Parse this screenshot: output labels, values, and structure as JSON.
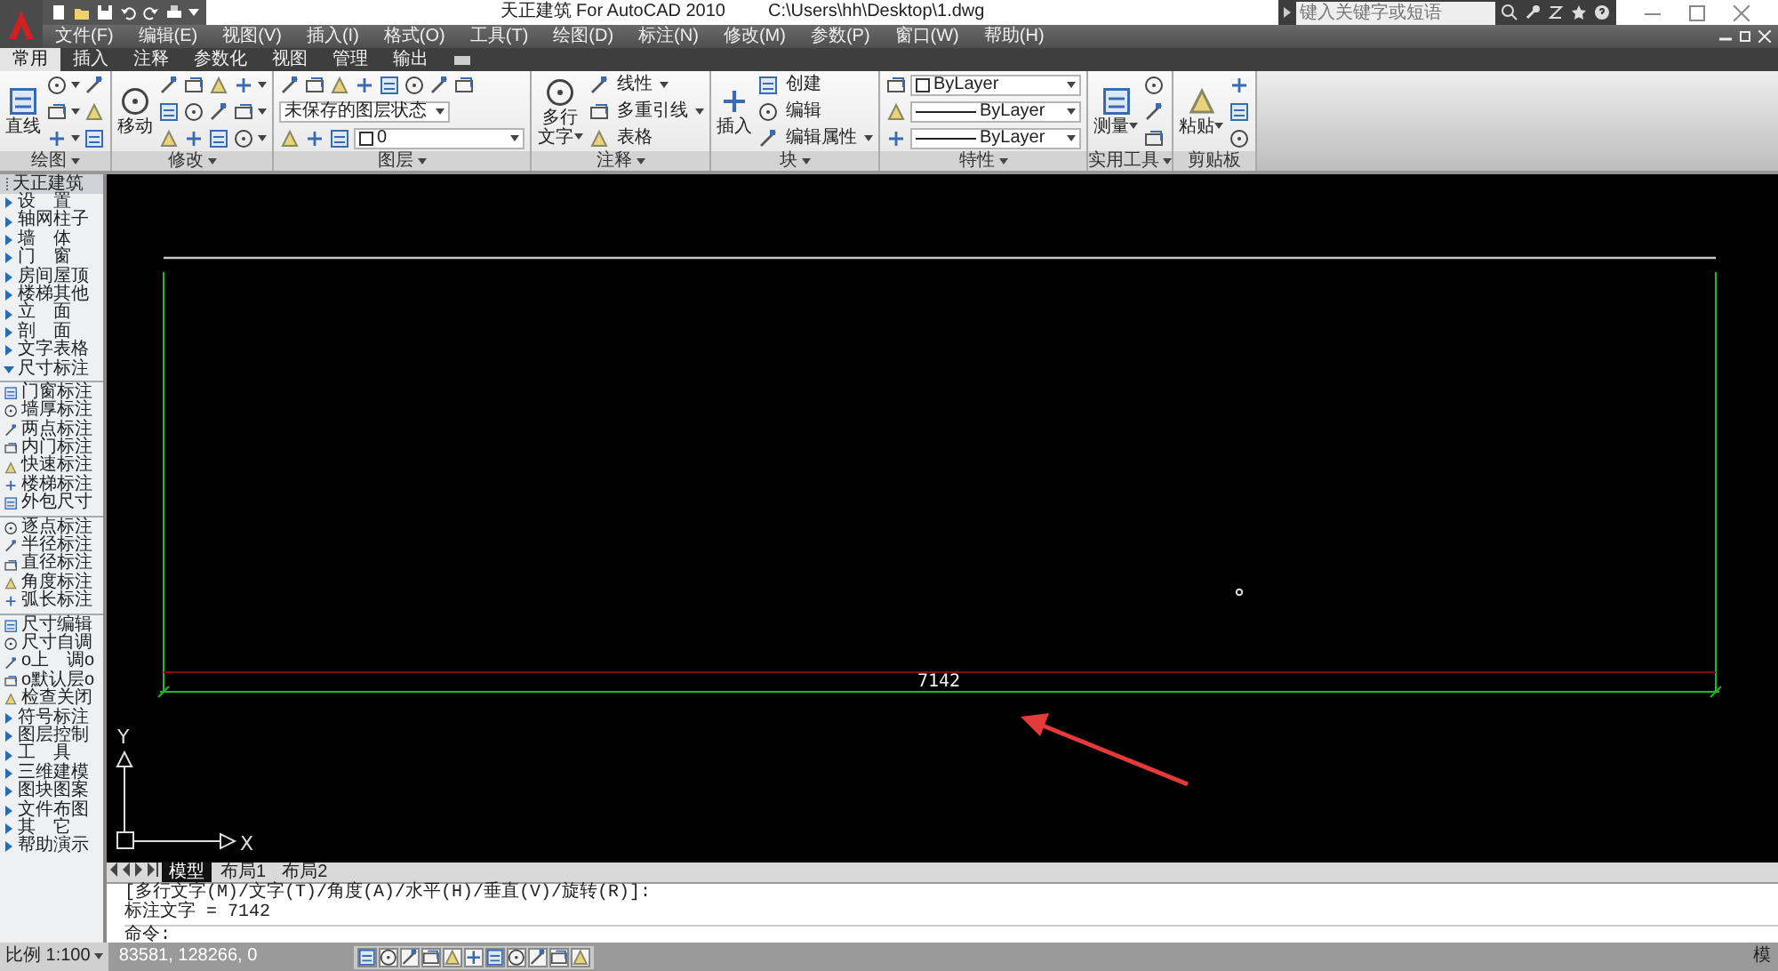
{
  "title_bar": {
    "app_title": "天正建筑 For AutoCAD 2010",
    "file_path": "C:\\Users\\hh\\Desktop\\1.dwg",
    "search": {
      "placeholder": "键入关键字或短语"
    }
  },
  "menu_bar": [
    "文件(F)",
    "编辑(E)",
    "视图(V)",
    "插入(I)",
    "格式(O)",
    "工具(T)",
    "绘图(D)",
    "标注(N)",
    "修改(M)",
    "参数(P)",
    "窗口(W)",
    "帮助(H)"
  ],
  "ribbon_tabs": [
    {
      "label": "常用",
      "selected": true
    },
    {
      "label": "插入",
      "selected": false
    },
    {
      "label": "注释",
      "selected": false
    },
    {
      "label": "参数化",
      "selected": false
    },
    {
      "label": "视图",
      "selected": false
    },
    {
      "label": "管理",
      "selected": false
    },
    {
      "label": "输出",
      "selected": false
    }
  ],
  "ribbon_panels": [
    {
      "title": "绘图",
      "title_menu": true,
      "large": [
        {
          "label": "直线",
          "menu": false
        }
      ],
      "rows": [
        [
          {
            "kind": "icon",
            "menu": true
          },
          {
            "kind": "icon",
            "menu": false
          }
        ],
        [
          {
            "kind": "icon",
            "menu": true
          },
          {
            "kind": "icon",
            "menu": false
          }
        ],
        [
          {
            "kind": "icon",
            "menu": true
          },
          {
            "kind": "icon",
            "menu": false
          }
        ]
      ]
    },
    {
      "title": "修改",
      "title_menu": true,
      "large": [
        {
          "label": "移动",
          "menu": false
        }
      ],
      "rows": [
        [
          {
            "kind": "icon",
            "menu": false
          },
          {
            "kind": "icon",
            "menu": false
          },
          {
            "kind": "icon",
            "menu": false
          },
          {
            "kind": "icon",
            "menu": true
          }
        ],
        [
          {
            "kind": "icon",
            "menu": false
          },
          {
            "kind": "icon",
            "menu": false
          },
          {
            "kind": "icon",
            "menu": false
          },
          {
            "kind": "icon",
            "menu": true
          }
        ],
        [
          {
            "kind": "icon",
            "menu": false
          },
          {
            "kind": "icon",
            "menu": false
          },
          {
            "kind": "icon",
            "menu": false
          },
          {
            "kind": "icon",
            "menu": true
          }
        ]
      ]
    },
    {
      "title": "图层",
      "title_menu": true,
      "rows": [
        [
          {
            "kind": "icon",
            "menu": false
          },
          {
            "kind": "icon",
            "menu": false
          },
          {
            "kind": "icon",
            "menu": false
          },
          {
            "kind": "icon",
            "menu": false
          },
          {
            "kind": "icon",
            "menu": false
          },
          {
            "kind": "icon",
            "menu": false
          },
          {
            "kind": "icon",
            "menu": false
          },
          {
            "kind": "icon",
            "menu": false
          }
        ],
        [
          {
            "kind": "dropdown",
            "value": "未保存的图层状态"
          }
        ],
        [
          {
            "kind": "icon",
            "menu": false
          },
          {
            "kind": "icon",
            "menu": false
          },
          {
            "kind": "icon",
            "menu": false
          },
          {
            "kind": "dropdown",
            "value": "0"
          }
        ]
      ]
    },
    {
      "title": "注释",
      "title_menu": true,
      "large": [
        {
          "label": "多行文字",
          "menu": true
        }
      ],
      "rows": [
        [
          {
            "kind": "labeled",
            "label": "线性",
            "menu": true
          }
        ],
        [
          {
            "kind": "labeled",
            "label": "多重引线",
            "menu": true
          }
        ],
        [
          {
            "kind": "labeled",
            "label": "表格",
            "menu": false
          }
        ]
      ]
    },
    {
      "title": "块",
      "title_menu": true,
      "large": [
        {
          "label": "插入",
          "menu": false
        }
      ],
      "rows": [
        [
          {
            "kind": "labeled",
            "label": "创建",
            "menu": false
          }
        ],
        [
          {
            "kind": "labeled",
            "label": "编辑",
            "menu": false
          }
        ],
        [
          {
            "kind": "labeled",
            "label": "编辑属性",
            "menu": true
          }
        ]
      ]
    },
    {
      "title": "特性",
      "title_menu": true,
      "rows": [
        [
          {
            "kind": "icon",
            "menu": false
          },
          {
            "kind": "dropdown",
            "value": "ByLayer"
          }
        ],
        [
          {
            "kind": "icon",
            "menu": false
          },
          {
            "kind": "dropdown",
            "value": "ByLayer"
          }
        ],
        [
          {
            "kind": "icon",
            "menu": false
          },
          {
            "kind": "dropdown",
            "value": "ByLayer"
          }
        ]
      ]
    },
    {
      "title": "实用工具",
      "title_menu": true,
      "large": [
        {
          "label": "测量",
          "menu": true
        }
      ],
      "rows": [
        [
          {
            "kind": "icon",
            "menu": false
          }
        ],
        [
          {
            "kind": "icon",
            "menu": false
          }
        ],
        [
          {
            "kind": "icon",
            "menu": false
          }
        ]
      ]
    },
    {
      "title": "剪贴板",
      "title_menu": false,
      "large": [
        {
          "label": "粘贴",
          "menu": true
        }
      ],
      "rows": [
        [
          {
            "kind": "icon",
            "menu": false
          }
        ],
        [
          {
            "kind": "icon",
            "menu": false
          }
        ],
        [
          {
            "kind": "icon",
            "menu": false
          }
        ]
      ]
    }
  ],
  "palette": {
    "title": "天正建筑",
    "items": [
      {
        "kind": "group",
        "label": "设　置",
        "expanded": false
      },
      {
        "kind": "group",
        "label": "轴网柱子",
        "expanded": false
      },
      {
        "kind": "group",
        "label": "墙　体",
        "expanded": false
      },
      {
        "kind": "group",
        "label": "门　窗",
        "expanded": false
      },
      {
        "kind": "group",
        "label": "房间屋顶",
        "expanded": false
      },
      {
        "kind": "group",
        "label": "楼梯其他",
        "expanded": false
      },
      {
        "kind": "group",
        "label": "立　面",
        "expanded": false
      },
      {
        "kind": "group",
        "label": "剖　面",
        "expanded": false
      },
      {
        "kind": "group",
        "label": "文字表格",
        "expanded": false
      },
      {
        "kind": "group",
        "label": "尺寸标注",
        "expanded": true
      },
      {
        "kind": "separator"
      },
      {
        "kind": "command",
        "label": "门窗标注"
      },
      {
        "kind": "command",
        "label": "墙厚标注"
      },
      {
        "kind": "command",
        "label": "两点标注"
      },
      {
        "kind": "command",
        "label": "内门标注"
      },
      {
        "kind": "command",
        "label": "快速标注"
      },
      {
        "kind": "command",
        "label": "楼梯标注"
      },
      {
        "kind": "command",
        "label": "外包尺寸"
      },
      {
        "kind": "separator"
      },
      {
        "kind": "command",
        "label": "逐点标注"
      },
      {
        "kind": "command",
        "label": "半径标注"
      },
      {
        "kind": "command",
        "label": "直径标注"
      },
      {
        "kind": "command",
        "label": "角度标注"
      },
      {
        "kind": "command",
        "label": "弧长标注"
      },
      {
        "kind": "separator"
      },
      {
        "kind": "command",
        "label": "尺寸编辑"
      },
      {
        "kind": "command",
        "label": "尺寸自调"
      },
      {
        "kind": "command",
        "label": "o上　调o"
      },
      {
        "kind": "command",
        "label": "o默认层o"
      },
      {
        "kind": "command",
        "label": "检查关闭"
      },
      {
        "kind": "group",
        "label": "符号标注",
        "expanded": false
      },
      {
        "kind": "group",
        "label": "图层控制",
        "expanded": false
      },
      {
        "kind": "group",
        "label": "工　具",
        "expanded": false
      },
      {
        "kind": "group",
        "label": "三维建模",
        "expanded": false
      },
      {
        "kind": "group",
        "label": "图块图案",
        "expanded": false
      },
      {
        "kind": "group",
        "label": "文件布图",
        "expanded": false
      },
      {
        "kind": "group",
        "label": "其　它",
        "expanded": false
      },
      {
        "kind": "group",
        "label": "帮助演示",
        "expanded": false
      }
    ]
  },
  "canvas": {
    "dimension_text": "7142",
    "x_label": "X",
    "y_label": "Y"
  },
  "layout_tabs": [
    {
      "label": "模型",
      "selected": true
    },
    {
      "label": "布局1",
      "selected": false
    },
    {
      "label": "布局2",
      "selected": false
    }
  ],
  "command_window": {
    "history": [
      "[多行文字(M)/文字(T)/角度(A)/水平(H)/垂直(V)/旋转(R)]:",
      "标注文字 = 7142"
    ],
    "prompt": "命令:"
  },
  "status_bar": {
    "scale": "比例 1:100",
    "coordinates": "83581, 128266, 0",
    "space_label": "模"
  }
}
